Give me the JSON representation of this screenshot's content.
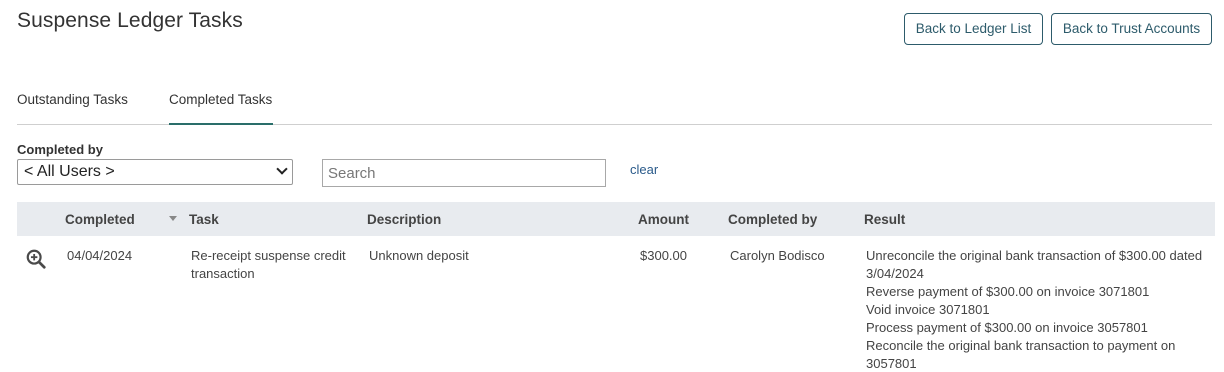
{
  "page": {
    "title": "Suspense Ledger Tasks",
    "back_ledger_label": "Back to Ledger List",
    "back_trust_label": "Back to Trust Accounts"
  },
  "tabs": {
    "outstanding": "Outstanding Tasks",
    "completed": "Completed Tasks",
    "active": "Completed Tasks"
  },
  "filters": {
    "completed_by_label": "Completed by",
    "completed_by_value": "< All Users >",
    "search_placeholder": "Search",
    "clear_label": "clear"
  },
  "table": {
    "headers": {
      "completed": "Completed",
      "task": "Task",
      "description": "Description",
      "amount": "Amount",
      "completed_by": "Completed by",
      "result": "Result"
    },
    "rows": [
      {
        "icon": "zoom-in-icon",
        "completed": "04/04/2024",
        "task": "Re-receipt suspense credit transaction",
        "description": "Unknown deposit",
        "amount": "$300.00",
        "completed_by": "Carolyn Bodisco",
        "result": [
          "Unreconcile the original bank transaction of $300.00 dated 3/04/2024",
          "Reverse payment of $300.00 on invoice 3071801",
          "Void invoice 3071801",
          "Process payment of $300.00 on invoice 3057801",
          "Reconcile the original bank transaction to payment on 3057801"
        ]
      }
    ]
  },
  "colors": {
    "accent": "#2d5b6b",
    "tab_underline": "#2a6e6a",
    "link": "#2a5a8a",
    "header_bg": "#e8ebef"
  }
}
